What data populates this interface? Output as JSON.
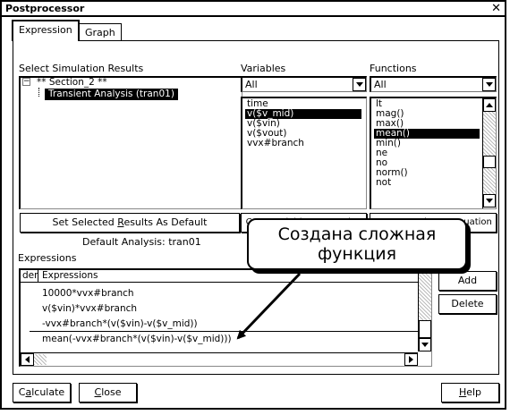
{
  "window": {
    "title": "Postprocessor"
  },
  "tabs": [
    {
      "label": "Expression"
    },
    {
      "label": "Graph"
    }
  ],
  "sim_results": {
    "label": "Select Simulation Results",
    "tree_toggle": "−",
    "root": "** Section_2 **",
    "child": "Transient Analysis (tran01)"
  },
  "variables": {
    "label": "Variables",
    "filter": "All",
    "items": [
      "time",
      "v($v_mid)",
      "v($vin)",
      "v($vout)",
      "vvx#branch"
    ],
    "selected_index": 1
  },
  "functions": {
    "label": "Functions",
    "filter": "All",
    "items": [
      "lt",
      "mag()",
      "max()",
      "mean()",
      "min()",
      "ne",
      "no",
      "norm()",
      "not"
    ],
    "selected_index": 3
  },
  "buttons": {
    "set_default_pre": "Set Selected ",
    "set_default_u": "R",
    "set_default_post": "esults As Default",
    "copy_variable": "Copy Variable to Equation",
    "copy_function": "Copy Function to Equation",
    "add": "Add",
    "delete": "Delete",
    "calculate_pre": "C",
    "calculate_u": "a",
    "calculate_post": "lculate",
    "close_u": "C",
    "close_post": "lose",
    "help_u": "H",
    "help_post": "elp"
  },
  "default_analysis": "Default Analysis: tran01",
  "expressions": {
    "label": "Expressions",
    "col_order": "der",
    "col_expr": "Expressions",
    "rows": [
      "10000*vvx#branch",
      "v($vin)*vvx#branch",
      "-vvx#branch*(v($vin)-v($v_mid))",
      "mean(-vvx#branch*(v($vin)-v($v_mid)))"
    ]
  },
  "callout": {
    "line1": "Создана сложная",
    "line2": "функция"
  }
}
